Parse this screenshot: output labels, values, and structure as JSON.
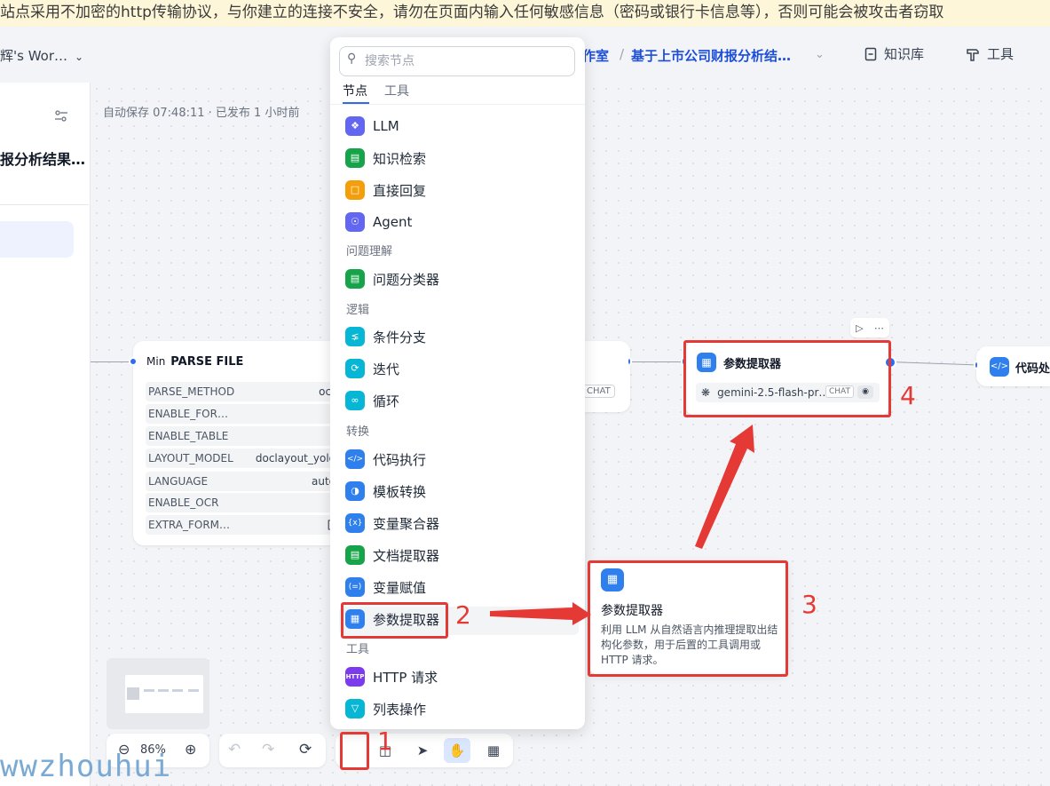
{
  "warning_bar": {
    "text": "站点采用不加密的http传输协议，与你建立的连接不安全，请勿在页面内输入任何敏感信息（密码或银行卡信息等），否则可能会被攻击者窃取"
  },
  "header": {
    "workspace": "辉's Wor…",
    "breadcrumb_studio": "作室",
    "breadcrumb_sep": "/",
    "breadcrumb_app": "基于上市公司财报分析结…",
    "nav": [
      {
        "label": "知识库"
      },
      {
        "label": "工具"
      }
    ]
  },
  "left_panel": {
    "app_title": "报分析结果…"
  },
  "canvas": {
    "autosave": "自动保存 07:48:11 · 已发布 1 小时前"
  },
  "parse_node": {
    "mini": "Min",
    "title": "PARSE FILE",
    "rows": [
      {
        "key": "PARSE_METHOD",
        "value": "ocr"
      },
      {
        "key": "ENABLE_FOR…",
        "value": ""
      },
      {
        "key": "ENABLE_TABLE",
        "value": ""
      },
      {
        "key": "LAYOUT_MODEL",
        "value": "doclayout_yolo"
      },
      {
        "key": "LANGUAGE",
        "value": "auto"
      },
      {
        "key": "ENABLE_OCR",
        "value": ""
      },
      {
        "key": "EXTRA_FORM…",
        "value": "[]"
      }
    ]
  },
  "llm_node": {
    "tag": "CHAT"
  },
  "param_node": {
    "title": "参数提取器",
    "model": "gemini-2.5-flash-pr…",
    "tag": "CHAT"
  },
  "code_node": {
    "title": "代码处"
  },
  "node_picker": {
    "search_placeholder": "搜索节点",
    "tabs": [
      {
        "label": "节点"
      },
      {
        "label": "工具"
      }
    ],
    "items": {
      "llm": "LLM",
      "knowledge": "知识检索",
      "answer": "直接回复",
      "agent": "Agent",
      "group_understand": "问题理解",
      "classifier": "问题分类器",
      "group_logic": "逻辑",
      "ifelse": "条件分支",
      "iteration": "迭代",
      "loop": "循环",
      "group_transform": "转换",
      "code": "代码执行",
      "template": "模板转换",
      "aggregator": "变量聚合器",
      "doc_extractor": "文档提取器",
      "assigner": "变量赋值",
      "param_extractor": "参数提取器",
      "group_tools": "工具",
      "http": "HTTP 请求",
      "list_op": "列表操作"
    },
    "http_icon_text": "HTTP"
  },
  "tooltip": {
    "title": "参数提取器",
    "desc": "利用 LLM 从自然语言内推理提取出结构化参数，用于后置的工具调用或 HTTP 请求。"
  },
  "zoom": {
    "level": "86%"
  },
  "annotations": {
    "n1": "1",
    "n2": "2",
    "n3": "3",
    "n4": "4"
  },
  "watermark": "wwzhouhui",
  "colors": {
    "accent": "#2f6bed",
    "annotation_red": "#e53935",
    "warning_bg": "#fdf6d8"
  }
}
